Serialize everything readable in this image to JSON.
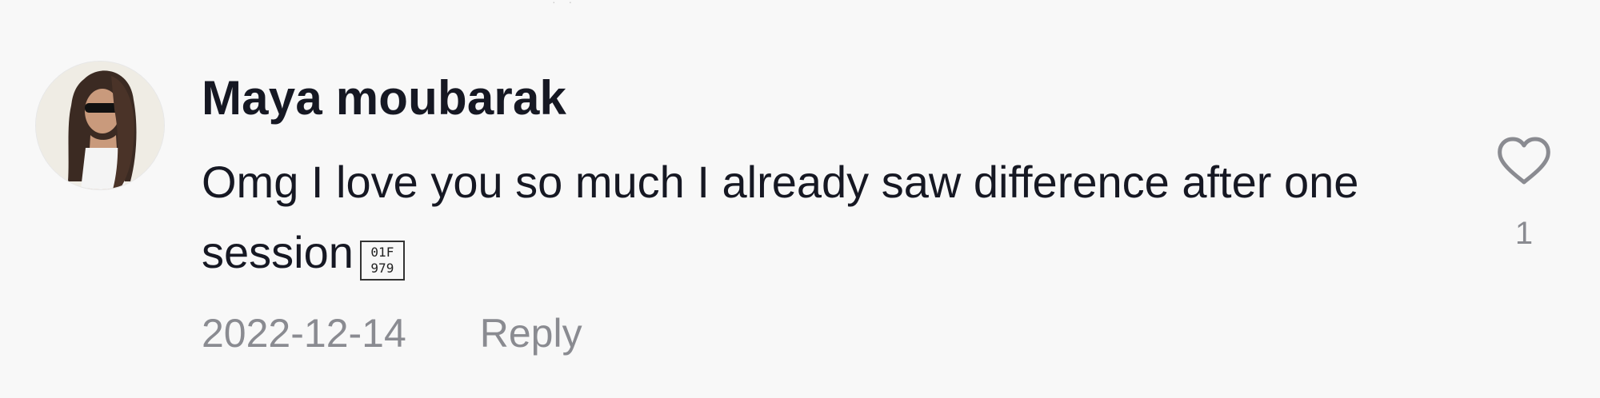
{
  "comment": {
    "author": "Maya moubarak",
    "text": "Omg I love you so much I already saw difference after one session",
    "emoji_glyph_hex": "01F979",
    "date": "2022-12-14",
    "reply_label": "Reply",
    "like_count": "1"
  },
  "icons": {
    "like": "heart-outline-icon",
    "avatar": "profile-photo"
  },
  "colors": {
    "background": "#f8f8f8",
    "text": "#161823",
    "secondary_text": "#8a8b91"
  }
}
